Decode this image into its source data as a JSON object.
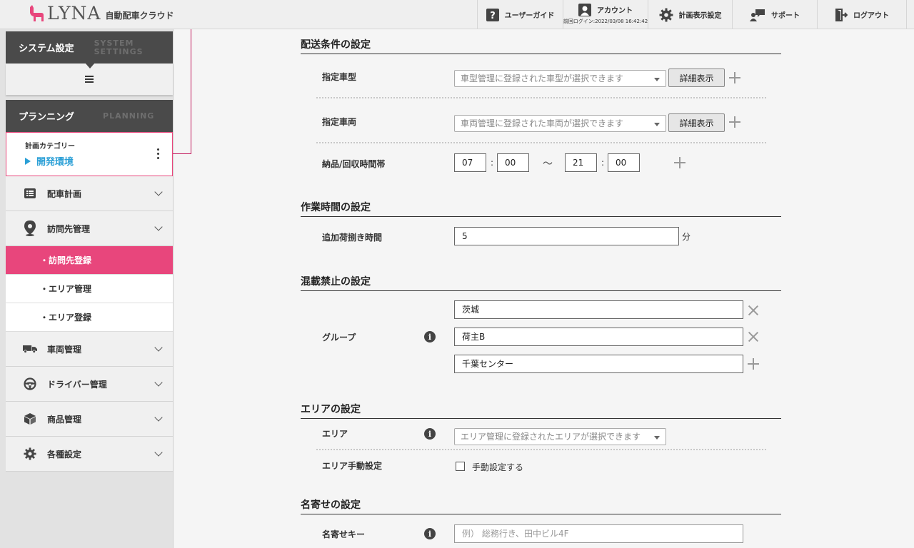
{
  "header": {
    "logo_text": "LYNA",
    "logo_sub": "自動配車クラウド",
    "nav": {
      "guide": "ユーザーガイド",
      "account": "アカウント",
      "last_login": "前回ログイン:2022/03/08 16:42:42",
      "display_settings": "計画表示設定",
      "support": "サポート",
      "logout": "ログアウト"
    }
  },
  "sidebar": {
    "system_title": "システム設定",
    "system_en": "SYSTEM SETTINGS",
    "planning_title": "プランニング",
    "planning_en": "PLANNING",
    "category_label": "計画カテゴリー",
    "category_value": "開発環境",
    "items": [
      {
        "label": "配車計画",
        "icon": "list-icon"
      },
      {
        "label": "訪問先管理",
        "icon": "map-pin-icon"
      }
    ],
    "sub_items": [
      "・訪問先登録",
      "・エリア管理",
      "・エリア登録"
    ],
    "items2": [
      {
        "label": "車両管理",
        "icon": "truck-icon"
      },
      {
        "label": "ドライバー管理",
        "icon": "steering-wheel-icon"
      },
      {
        "label": "商品管理",
        "icon": "box-icon"
      },
      {
        "label": "各種設定",
        "icon": "gear-icon"
      }
    ],
    "active_color": "#e8467c"
  },
  "delivery": {
    "title": "配送条件の設定",
    "vehicle_type_label": "指定車型",
    "vehicle_type_placeholder": "車型管理に登録された車型が選択できます",
    "vehicle_label": "指定車両",
    "vehicle_placeholder": "車両管理に登録された車両が選択できます",
    "detail_button": "詳細表示",
    "time_label": "納品/回収時間帯",
    "start_hour": "07",
    "start_min": "00",
    "end_hour": "21",
    "end_min": "00",
    "colon": ":",
    "tilde": "〜"
  },
  "work": {
    "title": "作業時間の設定",
    "extra_label": "追加荷捌き時間",
    "extra_value": "5",
    "unit": "分"
  },
  "mix": {
    "title": "混載禁止の設定",
    "group_label": "グループ",
    "groups": [
      "茨城",
      "荷主B",
      "千葉センター"
    ]
  },
  "area": {
    "title": "エリアの設定",
    "area_label": "エリア",
    "area_placeholder": "エリア管理に登録されたエリアが選択できます",
    "manual_label": "エリア手動設定",
    "manual_checkbox": "手動設定する"
  },
  "naming": {
    "title": "名寄せの設定",
    "key_label": "名寄せキー",
    "key_placeholder": "例） 総務行き、田中ビル4F"
  }
}
